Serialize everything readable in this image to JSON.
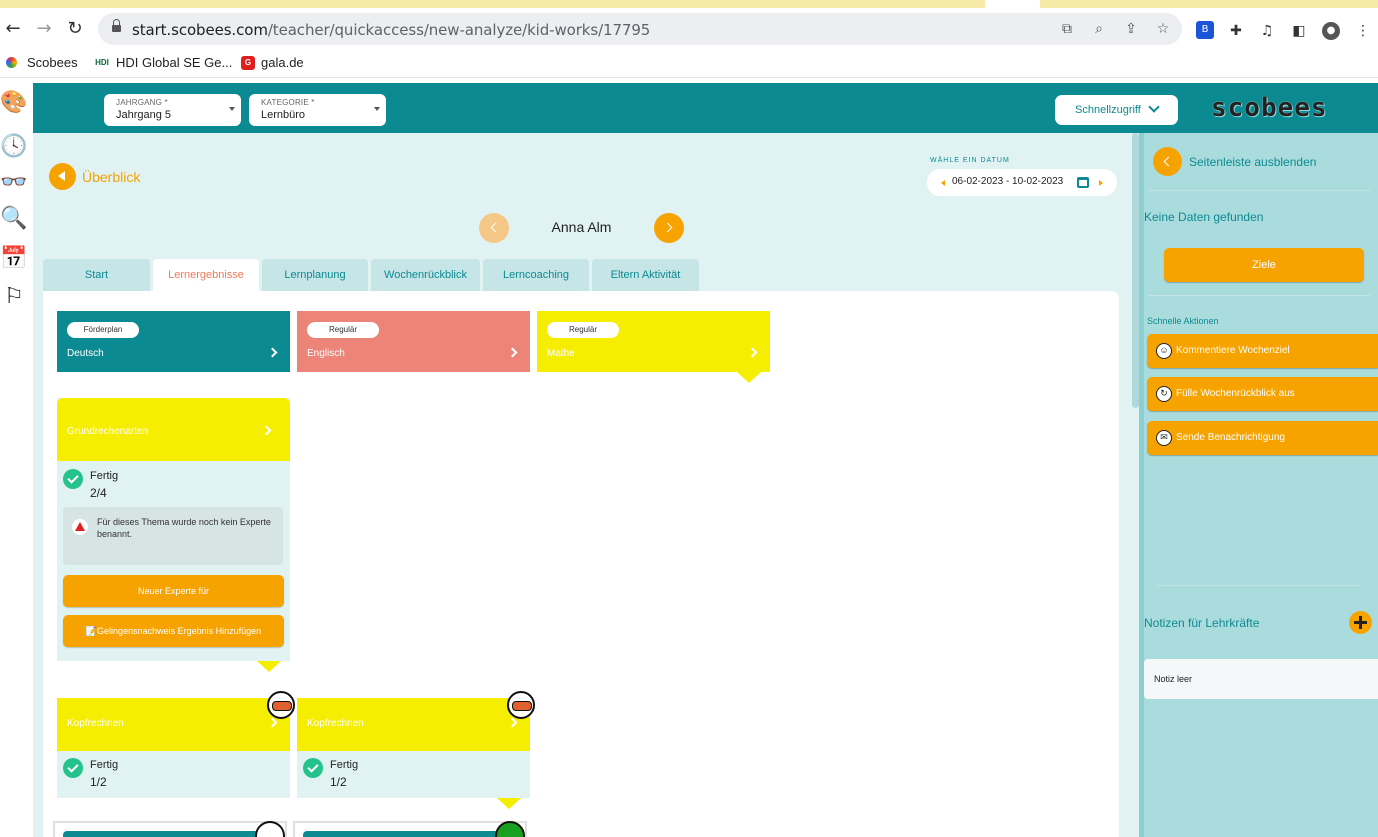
{
  "browser": {
    "url_host": "start.scobees.com",
    "url_path": "/teacher/quickaccess/new-analyze/kid-works/17795",
    "bookmarks": [
      {
        "label": "Scobees",
        "icon": "scobees-favicon"
      },
      {
        "label": "HDI Global SE Ge...",
        "icon": "hdi-favicon",
        "short": "HDI"
      },
      {
        "label": "gala.de",
        "icon": "gala-favicon",
        "short": "G"
      }
    ]
  },
  "header": {
    "jahrgang_label": "JAHRGANG *",
    "jahrgang_value": "Jahrgang 5",
    "kategorie_label": "KATEGORIE *",
    "kategorie_value": "Lernbüro",
    "quick_access": "Schnellzugriff",
    "logo": "scobees"
  },
  "main": {
    "back_label": "Überblick",
    "date_label": "WÄHLE EIN DATUM",
    "date_range": "06-02-2023 - 10-02-2023",
    "student_name": "Anna Alm",
    "tabs": [
      {
        "label": "Start",
        "active": false
      },
      {
        "label": "Lernergebnisse",
        "active": true
      },
      {
        "label": "Lernplanung",
        "active": false
      },
      {
        "label": "Wochenrückblick",
        "active": false
      },
      {
        "label": "Lerncoaching",
        "active": false
      },
      {
        "label": "Eltern Aktivität",
        "active": false
      }
    ],
    "subjects": [
      {
        "type": "Förderplan",
        "name": "Deutsch",
        "color": "#0c8a92"
      },
      {
        "type": "Regulär",
        "name": "Englisch",
        "color": "#ec8478"
      },
      {
        "type": "Regulär",
        "name": "Mathe",
        "color": "#f5ee00"
      }
    ],
    "topic": {
      "title": "Grundrechenarten",
      "status": "Fertig",
      "count": "2/4",
      "warning": "Für dieses Thema wurde noch kein Experte benannt.",
      "btn_expert": "Neuer Experte für",
      "btn_result": "📝Gelingensnachweis Ergebnis Hinzufügen"
    },
    "subtopics": [
      {
        "title": "Kopfrechnen",
        "status": "Fertig",
        "count": "1/2"
      },
      {
        "title": "Kopfrechnen",
        "status": "Fertig",
        "count": "1/2"
      }
    ]
  },
  "sidebar": {
    "hide_label": "Seitenleiste ausblenden",
    "no_data": "Keine Daten gefunden",
    "goals_button": "Ziele",
    "quick_actions_title": "Schnelle Aktionen",
    "quick_actions": [
      {
        "label": "Kommentiere Wochenziel",
        "icon": "smiley-icon"
      },
      {
        "label": "Fülle Wochenrückblick aus",
        "icon": "refresh-face-icon"
      },
      {
        "label": "Sende Benachrichtigung",
        "icon": "chat-icon"
      }
    ],
    "notes_title": "Notizen für Lehrkräfte",
    "note_empty": "Notiz leer"
  }
}
